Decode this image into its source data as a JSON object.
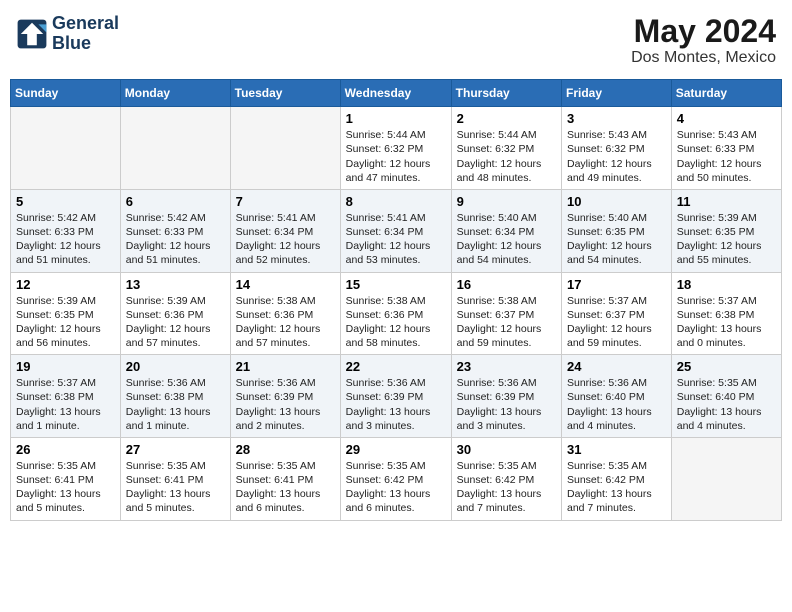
{
  "header": {
    "logo_line1": "General",
    "logo_line2": "Blue",
    "month_year": "May 2024",
    "location": "Dos Montes, Mexico"
  },
  "weekdays": [
    "Sunday",
    "Monday",
    "Tuesday",
    "Wednesday",
    "Thursday",
    "Friday",
    "Saturday"
  ],
  "weeks": [
    [
      {
        "day": "",
        "text": ""
      },
      {
        "day": "",
        "text": ""
      },
      {
        "day": "",
        "text": ""
      },
      {
        "day": "1",
        "text": "Sunrise: 5:44 AM\nSunset: 6:32 PM\nDaylight: 12 hours\nand 47 minutes."
      },
      {
        "day": "2",
        "text": "Sunrise: 5:44 AM\nSunset: 6:32 PM\nDaylight: 12 hours\nand 48 minutes."
      },
      {
        "day": "3",
        "text": "Sunrise: 5:43 AM\nSunset: 6:32 PM\nDaylight: 12 hours\nand 49 minutes."
      },
      {
        "day": "4",
        "text": "Sunrise: 5:43 AM\nSunset: 6:33 PM\nDaylight: 12 hours\nand 50 minutes."
      }
    ],
    [
      {
        "day": "5",
        "text": "Sunrise: 5:42 AM\nSunset: 6:33 PM\nDaylight: 12 hours\nand 51 minutes."
      },
      {
        "day": "6",
        "text": "Sunrise: 5:42 AM\nSunset: 6:33 PM\nDaylight: 12 hours\nand 51 minutes."
      },
      {
        "day": "7",
        "text": "Sunrise: 5:41 AM\nSunset: 6:34 PM\nDaylight: 12 hours\nand 52 minutes."
      },
      {
        "day": "8",
        "text": "Sunrise: 5:41 AM\nSunset: 6:34 PM\nDaylight: 12 hours\nand 53 minutes."
      },
      {
        "day": "9",
        "text": "Sunrise: 5:40 AM\nSunset: 6:34 PM\nDaylight: 12 hours\nand 54 minutes."
      },
      {
        "day": "10",
        "text": "Sunrise: 5:40 AM\nSunset: 6:35 PM\nDaylight: 12 hours\nand 54 minutes."
      },
      {
        "day": "11",
        "text": "Sunrise: 5:39 AM\nSunset: 6:35 PM\nDaylight: 12 hours\nand 55 minutes."
      }
    ],
    [
      {
        "day": "12",
        "text": "Sunrise: 5:39 AM\nSunset: 6:35 PM\nDaylight: 12 hours\nand 56 minutes."
      },
      {
        "day": "13",
        "text": "Sunrise: 5:39 AM\nSunset: 6:36 PM\nDaylight: 12 hours\nand 57 minutes."
      },
      {
        "day": "14",
        "text": "Sunrise: 5:38 AM\nSunset: 6:36 PM\nDaylight: 12 hours\nand 57 minutes."
      },
      {
        "day": "15",
        "text": "Sunrise: 5:38 AM\nSunset: 6:36 PM\nDaylight: 12 hours\nand 58 minutes."
      },
      {
        "day": "16",
        "text": "Sunrise: 5:38 AM\nSunset: 6:37 PM\nDaylight: 12 hours\nand 59 minutes."
      },
      {
        "day": "17",
        "text": "Sunrise: 5:37 AM\nSunset: 6:37 PM\nDaylight: 12 hours\nand 59 minutes."
      },
      {
        "day": "18",
        "text": "Sunrise: 5:37 AM\nSunset: 6:38 PM\nDaylight: 13 hours\nand 0 minutes."
      }
    ],
    [
      {
        "day": "19",
        "text": "Sunrise: 5:37 AM\nSunset: 6:38 PM\nDaylight: 13 hours\nand 1 minute."
      },
      {
        "day": "20",
        "text": "Sunrise: 5:36 AM\nSunset: 6:38 PM\nDaylight: 13 hours\nand 1 minute."
      },
      {
        "day": "21",
        "text": "Sunrise: 5:36 AM\nSunset: 6:39 PM\nDaylight: 13 hours\nand 2 minutes."
      },
      {
        "day": "22",
        "text": "Sunrise: 5:36 AM\nSunset: 6:39 PM\nDaylight: 13 hours\nand 3 minutes."
      },
      {
        "day": "23",
        "text": "Sunrise: 5:36 AM\nSunset: 6:39 PM\nDaylight: 13 hours\nand 3 minutes."
      },
      {
        "day": "24",
        "text": "Sunrise: 5:36 AM\nSunset: 6:40 PM\nDaylight: 13 hours\nand 4 minutes."
      },
      {
        "day": "25",
        "text": "Sunrise: 5:35 AM\nSunset: 6:40 PM\nDaylight: 13 hours\nand 4 minutes."
      }
    ],
    [
      {
        "day": "26",
        "text": "Sunrise: 5:35 AM\nSunset: 6:41 PM\nDaylight: 13 hours\nand 5 minutes."
      },
      {
        "day": "27",
        "text": "Sunrise: 5:35 AM\nSunset: 6:41 PM\nDaylight: 13 hours\nand 5 minutes."
      },
      {
        "day": "28",
        "text": "Sunrise: 5:35 AM\nSunset: 6:41 PM\nDaylight: 13 hours\nand 6 minutes."
      },
      {
        "day": "29",
        "text": "Sunrise: 5:35 AM\nSunset: 6:42 PM\nDaylight: 13 hours\nand 6 minutes."
      },
      {
        "day": "30",
        "text": "Sunrise: 5:35 AM\nSunset: 6:42 PM\nDaylight: 13 hours\nand 7 minutes."
      },
      {
        "day": "31",
        "text": "Sunrise: 5:35 AM\nSunset: 6:42 PM\nDaylight: 13 hours\nand 7 minutes."
      },
      {
        "day": "",
        "text": ""
      }
    ]
  ]
}
